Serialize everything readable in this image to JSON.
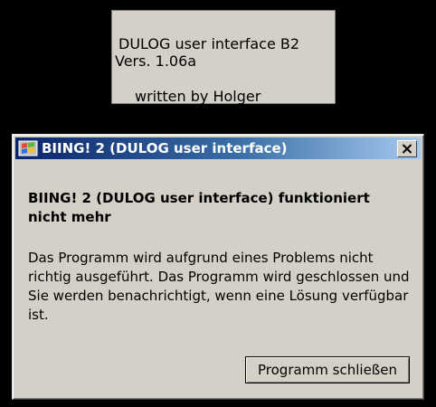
{
  "splash": {
    "line1": "DULOG user interface B2",
    "line2": "Vers. 1.06a",
    "line3": "written by Holger"
  },
  "dialog": {
    "title": "BIING! 2 (DULOG user interface)",
    "app_icon": "windows-flag-icon",
    "close_icon": "close-icon",
    "heading": "BIING! 2 (DULOG user interface) funktioniert nicht mehr",
    "message": "Das Programm wird aufgrund eines Problems nicht richtig ausgeführt. Das Programm wird geschlossen und Sie werden benachrichtigt, wenn eine Lösung verfügbar ist.",
    "button_label": "Programm schließen"
  },
  "colors": {
    "background": "#000000",
    "window_face": "#d4d0c8",
    "titlebar_start": "#0a246a",
    "titlebar_end": "#a6caf0"
  }
}
